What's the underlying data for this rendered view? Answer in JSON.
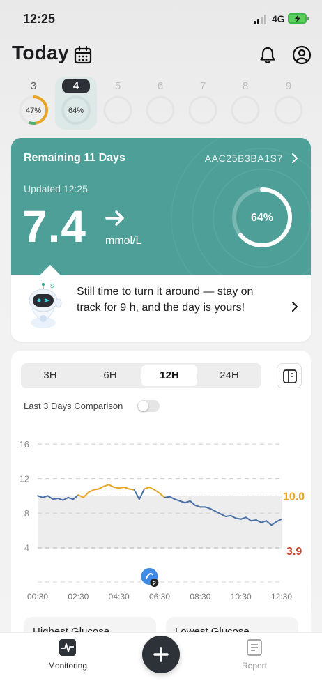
{
  "status_bar": {
    "time": "12:25",
    "network": "4G"
  },
  "header": {
    "title": "Today"
  },
  "days": [
    {
      "day": "3",
      "percent_label": "47%",
      "progress": 0.47
    },
    {
      "day": "4",
      "percent_label": "64%",
      "progress": 0.64,
      "active": true
    },
    {
      "day": "5"
    },
    {
      "day": "6"
    },
    {
      "day": "7"
    },
    {
      "day": "8"
    },
    {
      "day": "9"
    }
  ],
  "sensor": {
    "remaining": "Remaining 11 Days",
    "serial": "AAC25B3BA1S7",
    "updated": "Updated 12:25",
    "value": "7.4",
    "unit": "mmol/L",
    "trend": "steady",
    "ring_label": "64%",
    "ring_progress": 0.64
  },
  "tip": {
    "text": "Still time to turn it around — stay on track for 9 h, and the day is yours!"
  },
  "colors": {
    "teal": "#4d9f98",
    "high": "#e8a423",
    "low": "#c8452f",
    "line": "#4a6fa5"
  },
  "chart_panel": {
    "ranges": [
      "3H",
      "6H",
      "12H",
      "24H"
    ],
    "selected_range": "12H",
    "compare_label": "Last 3 Days Comparison",
    "compare_on": false
  },
  "chart_data": {
    "type": "line",
    "xlabels": [
      "00:30",
      "02:30",
      "04:30",
      "06:30",
      "08:30",
      "10:30",
      "12:30"
    ],
    "yticks": [
      4,
      8,
      12,
      16
    ],
    "ylim": [
      0,
      16.5
    ],
    "target_range": [
      3.9,
      10.0
    ],
    "target_high_label": "10.0",
    "target_low_label": "3.9",
    "event_marker": {
      "time": "06:00",
      "count": "2"
    },
    "x": [
      0,
      0.25,
      0.5,
      0.75,
      1,
      1.25,
      1.5,
      1.75,
      2,
      2.25,
      2.5,
      2.75,
      3,
      3.25,
      3.5,
      3.75,
      4,
      4.25,
      4.5,
      4.75,
      5,
      5.25,
      5.5,
      5.75,
      6,
      6.25,
      6.5,
      6.75,
      7,
      7.25,
      7.5,
      7.75,
      8,
      8.25,
      8.5,
      8.75,
      9,
      9.25,
      9.5,
      9.75,
      10,
      10.25,
      10.5,
      10.75,
      11,
      11.25,
      11.5,
      11.75,
      12
    ],
    "y": [
      10.0,
      9.8,
      10.0,
      9.6,
      9.7,
      9.5,
      9.8,
      9.6,
      10.1,
      9.8,
      10.4,
      10.7,
      10.8,
      11.1,
      11.3,
      11.0,
      10.9,
      11.0,
      10.8,
      10.7,
      9.6,
      10.8,
      11.0,
      10.7,
      10.3,
      9.8,
      9.9,
      9.6,
      9.4,
      9.2,
      9.4,
      8.9,
      8.7,
      8.7,
      8.5,
      8.2,
      7.9,
      7.6,
      7.7,
      7.4,
      7.3,
      7.5,
      7.1,
      7.2,
      6.9,
      7.1,
      6.6,
      7.0,
      7.3
    ]
  },
  "summary_cards": [
    "Highest Glucose",
    "Lowest Glucose"
  ],
  "nav": {
    "monitoring": "Monitoring",
    "report": "Report"
  }
}
